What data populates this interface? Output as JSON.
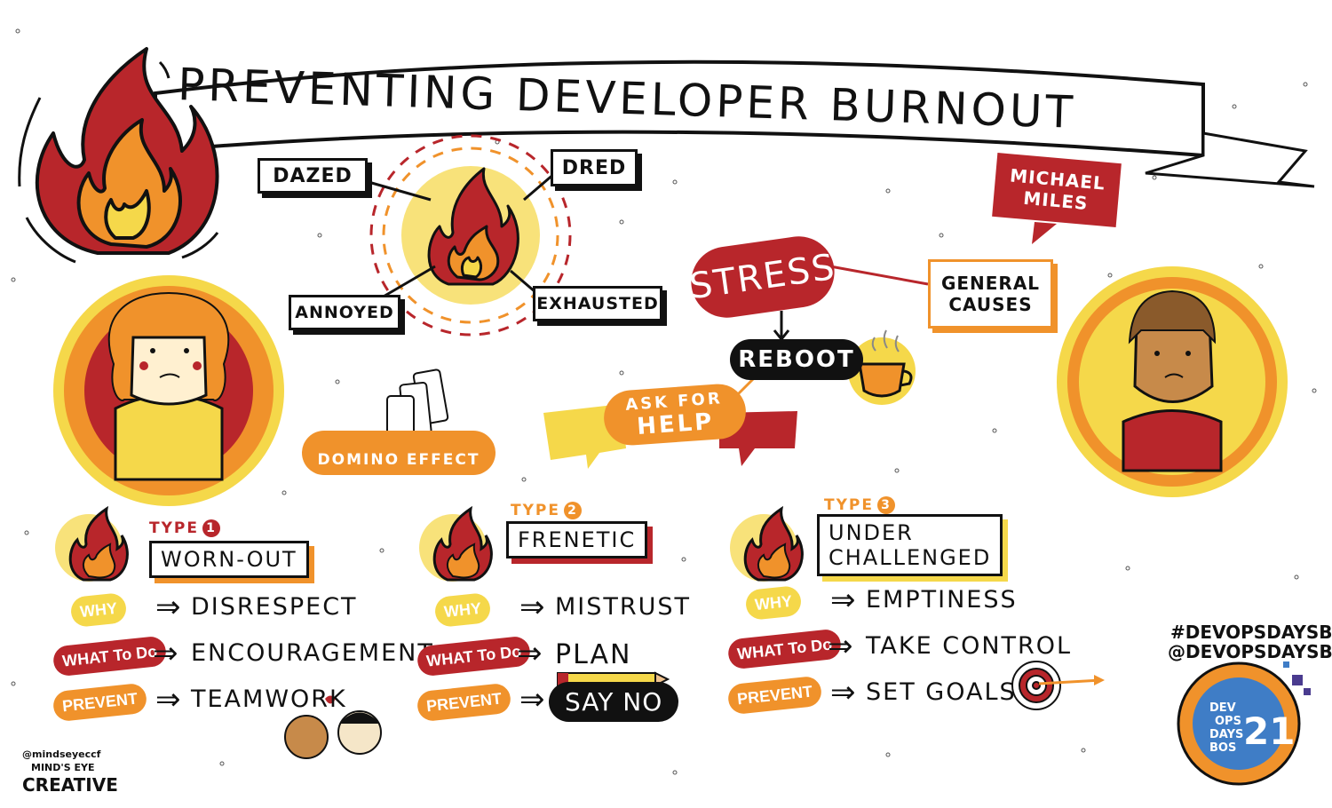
{
  "title": "PREVENTING DEVELOPER BURNOUT",
  "feelings": [
    "DAZED",
    "DRED",
    "ANNOYED",
    "EXHAUSTED"
  ],
  "speaker": "MICHAEL MILES",
  "center": {
    "stress": "STRESS",
    "reboot": "REBOOT",
    "ask_for_help": [
      "ASK FOR",
      "HELP"
    ],
    "general_causes": [
      "GENERAL",
      "CAUSES"
    ],
    "domino": "DOMINO EFFECT"
  },
  "types": [
    {
      "type_label": "TYPE",
      "number": "1",
      "name": [
        "WORN-OUT"
      ],
      "why": "DISRESPECT",
      "what_to_do": "ENCOURAGEMENT",
      "prevent": "TEAMWORK"
    },
    {
      "type_label": "TYPE",
      "number": "2",
      "name": [
        "FRENETIC"
      ],
      "why": "MISTRUST",
      "what_to_do": "PLAN",
      "prevent": "SAY NO"
    },
    {
      "type_label": "TYPE",
      "number": "3",
      "name": [
        "UNDER",
        "CHALLENGED"
      ],
      "why": "EMPTINESS",
      "what_to_do": "TAKE CONTROL",
      "prevent": "SET GOALS"
    }
  ],
  "row_labels": {
    "why": "WHY",
    "what_to_do": "WHAT To Do",
    "prevent": "PREVENT"
  },
  "hashtags": [
    "#DEVOPSDAYSBOS",
    "@DEVOPSDAYSBOS"
  ],
  "event_logo": {
    "lines": [
      "DEV",
      "OPS",
      "DAYS",
      "BOS"
    ],
    "year": "21"
  },
  "credit": {
    "handle": "@mindseyeccf",
    "name": "MIND'S EYE",
    "sub": "CREATIVE"
  },
  "colors": {
    "red": "#b8262b",
    "orange": "#f0922b",
    "yellow": "#f5d84a",
    "pale_yellow": "#f8e27a",
    "black": "#111111"
  }
}
